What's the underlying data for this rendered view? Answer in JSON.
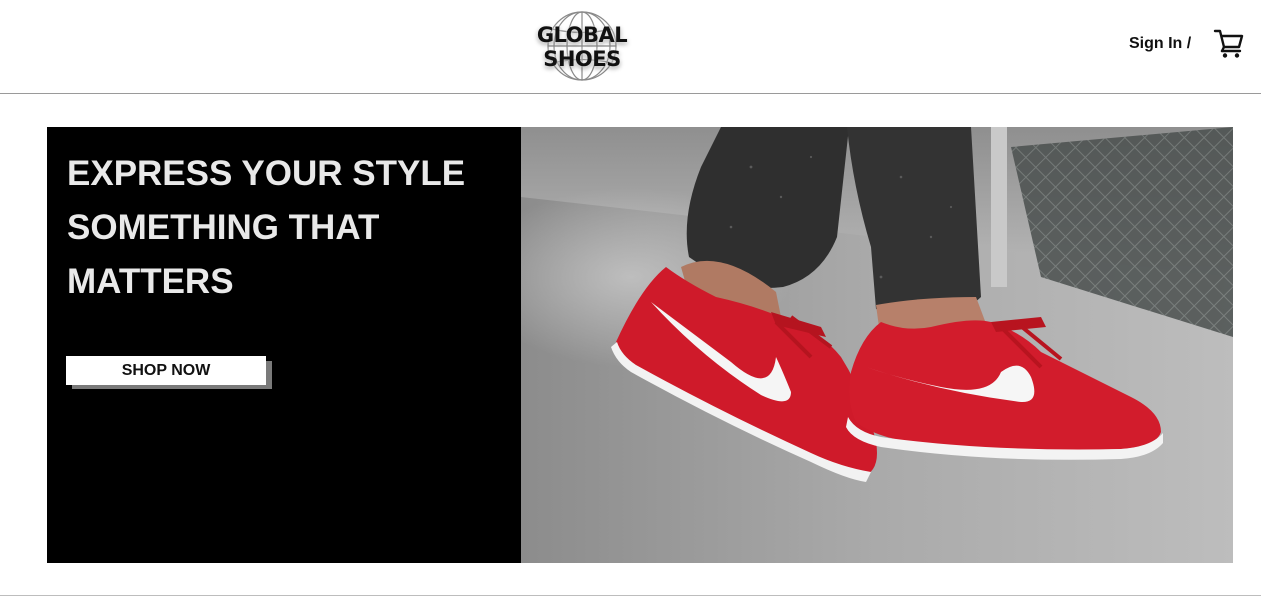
{
  "header": {
    "logo": {
      "line1": "GLOBAL",
      "line2": "SHOES",
      "icon": "globe-icon"
    },
    "signin_label": "Sign In /",
    "cart_icon": "cart-icon"
  },
  "hero": {
    "heading_lines": [
      "EXPRESS YOUR STYLE",
      "SOMETHING THAT",
      "MATTERS"
    ],
    "cta_label": "SHOP NOW",
    "image": "red-sneakers-photo"
  },
  "colors": {
    "hero_bg": "#000000",
    "heading_text": "#e9e9e9",
    "sneaker_red": "#cf1a2a",
    "button_bg": "#ffffff"
  }
}
